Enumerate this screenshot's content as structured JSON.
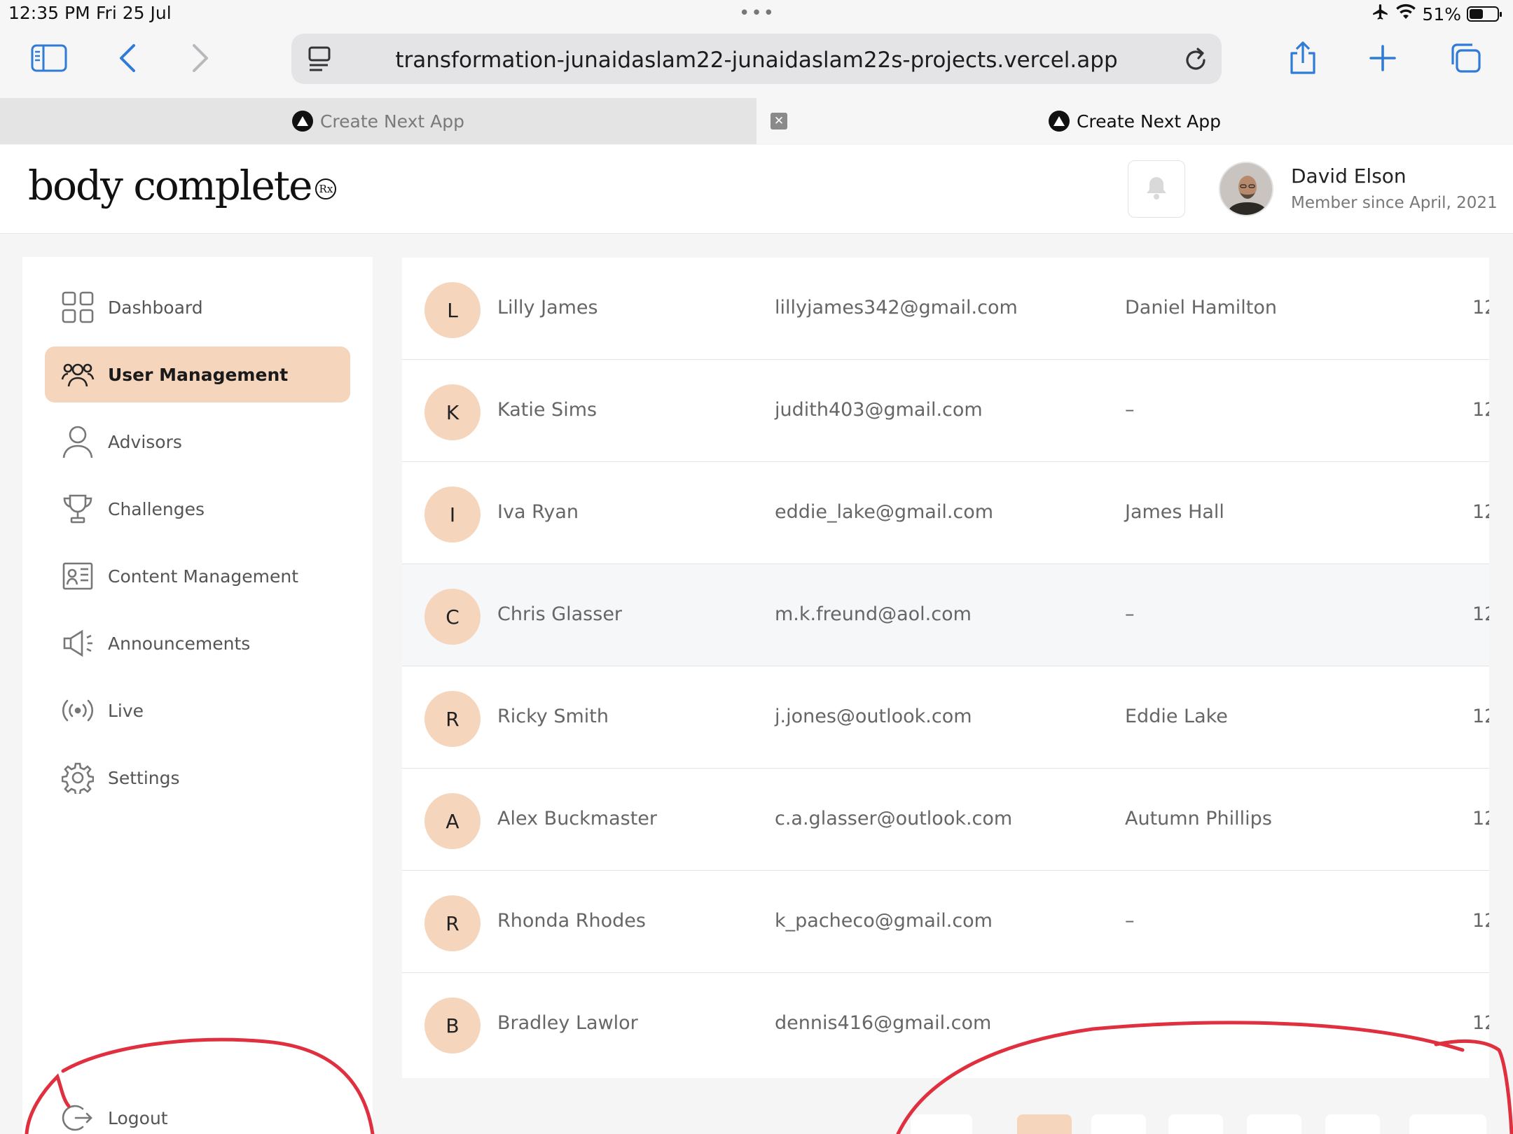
{
  "status_bar": {
    "time": "12:35 PM",
    "date": "Fri 25 Jul",
    "battery": "51%"
  },
  "browser": {
    "url": "transformation-junaidaslam22-junaidaslam22s-projects.vercel.app",
    "tabs": [
      {
        "label": "Create Next App",
        "active": false
      },
      {
        "label": "Create Next App",
        "active": true
      }
    ]
  },
  "header": {
    "logo": "body complete",
    "logo_mark": "Rx",
    "user_name": "David Elson",
    "user_subtitle": "Member since April, 2021"
  },
  "sidebar": {
    "items": [
      {
        "label": "Dashboard",
        "icon": "grid-icon"
      },
      {
        "label": "User Management",
        "icon": "users-icon",
        "active": true
      },
      {
        "label": "Advisors",
        "icon": "person-icon"
      },
      {
        "label": "Challenges",
        "icon": "trophy-icon"
      },
      {
        "label": "Content Management",
        "icon": "content-icon"
      },
      {
        "label": "Announcements",
        "icon": "megaphone-icon"
      },
      {
        "label": "Live",
        "icon": "broadcast-icon"
      },
      {
        "label": "Settings",
        "icon": "gear-icon"
      }
    ],
    "logout": "Logout"
  },
  "users": [
    {
      "initial": "L",
      "name": "Lilly James",
      "email": "lillyjames342@gmail.com",
      "advisor": "Daniel Hamilton",
      "date": "12"
    },
    {
      "initial": "K",
      "name": "Katie Sims",
      "email": "judith403@gmail.com",
      "advisor": "–",
      "date": "12"
    },
    {
      "initial": "I",
      "name": "Iva Ryan",
      "email": "eddie_lake@gmail.com",
      "advisor": "James Hall",
      "date": "12"
    },
    {
      "initial": "C",
      "name": "Chris Glasser",
      "email": "m.k.freund@aol.com",
      "advisor": "–",
      "date": "12"
    },
    {
      "initial": "R",
      "name": "Ricky Smith",
      "email": "j.jones@outlook.com",
      "advisor": "Eddie Lake",
      "date": "12"
    },
    {
      "initial": "A",
      "name": "Alex Buckmaster",
      "email": "c.a.glasser@outlook.com",
      "advisor": "Autumn Phillips",
      "date": "12"
    },
    {
      "initial": "R",
      "name": "Rhonda Rhodes",
      "email": "k_pacheco@gmail.com",
      "advisor": "–",
      "date": "12"
    },
    {
      "initial": "B",
      "name": "Bradley Lawlor",
      "email": "dennis416@gmail.com",
      "advisor": "",
      "date": "12"
    }
  ],
  "colors": {
    "accent": "#f6d5bd",
    "annotation": "#e0303f"
  }
}
